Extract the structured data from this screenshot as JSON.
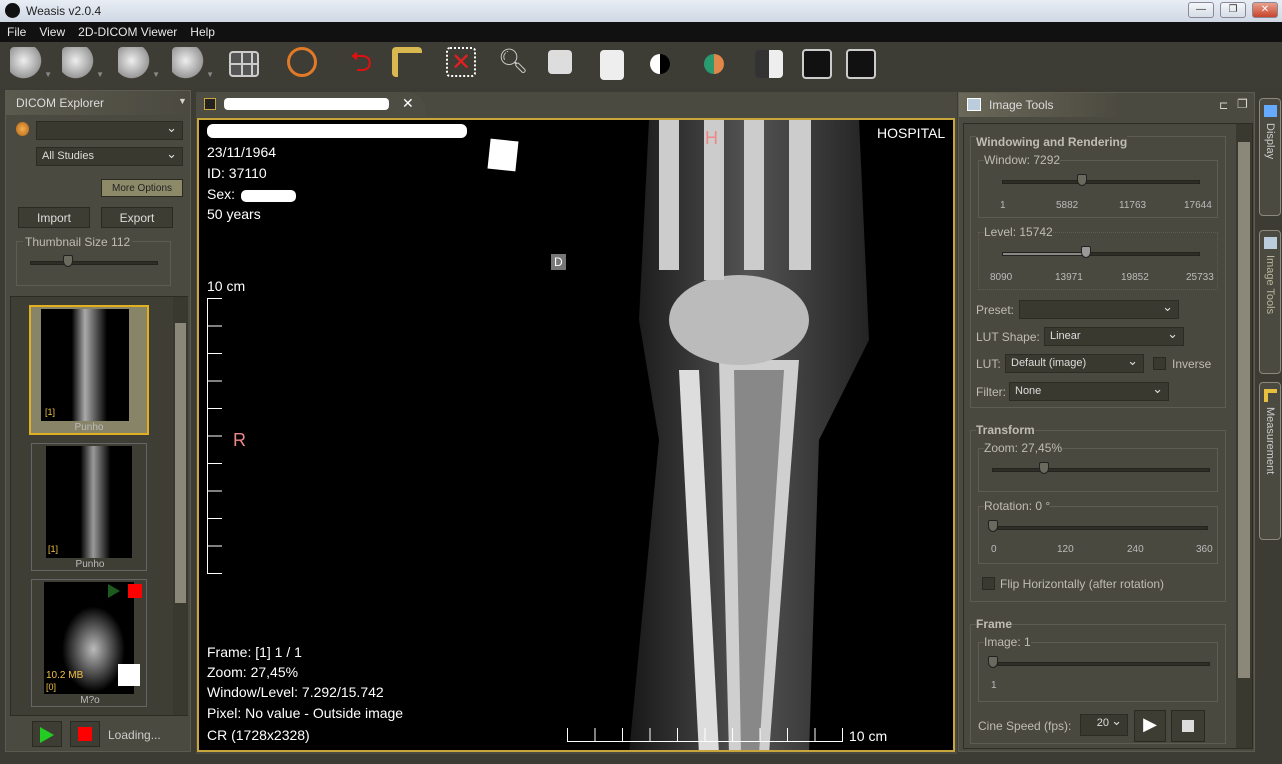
{
  "window": {
    "title": "Weasis v2.0.4",
    "controls": [
      "—",
      "❐",
      "✕"
    ]
  },
  "menu": [
    "File",
    "View",
    "2D-DICOM Viewer",
    "Help"
  ],
  "toolbar": [
    "mouse-contrast",
    "mouse-pan",
    "mouse-series",
    "mouse-stack",
    "layout-grid",
    "synchronize",
    "reset",
    "measure-ruler",
    "delete-selection",
    "zoom-magnifier",
    "lens",
    "dicom-file",
    "invert-lut",
    "color-lut",
    "contrast-lut",
    "crosshair-mpr",
    "spine-view"
  ],
  "explorer": {
    "title": "DICOM Explorer",
    "patient": "",
    "studies": "All Studies",
    "more_options": "More Options",
    "import": "Import",
    "export": "Export",
    "thumb_size_label": "Thumbnail Size 112",
    "thumb_size": 112,
    "thumbnails": [
      {
        "label": "Punho",
        "index": "[1]",
        "selected": true
      },
      {
        "label": "Punho",
        "index": "[1]",
        "selected": false
      },
      {
        "label": "M?o",
        "index": "[0]",
        "size": "10.2 MB",
        "selected": false
      }
    ],
    "loading": "Loading..."
  },
  "viewer": {
    "tab_title": "",
    "overlay": {
      "dob": "23/11/1964",
      "id": "ID: 37110",
      "sex": "Sex:",
      "age": "50 years",
      "institution": "HOSPITAL",
      "orient_top": "H",
      "orient_left": "R",
      "marker": "D",
      "scale_v": "10 cm",
      "scale_h": "10 cm",
      "frame": "Frame: [1] 1 / 1",
      "zoom": "Zoom: 27,45%",
      "wl": "Window/Level: 7.292/15.742",
      "pixel": "Pixel: No value - Outside image",
      "modality": "CR (1728x2328)"
    }
  },
  "image_tools": {
    "title": "Image Tools",
    "windowing": {
      "title": "Windowing and Rendering",
      "window_label": "Window: 7292",
      "window_value": 7292,
      "window_ticks": [
        "1",
        "5882",
        "11763",
        "17644"
      ],
      "level_label": "Level: 15742",
      "level_value": 15742,
      "level_ticks": [
        "8090",
        "13971",
        "19852",
        "25733"
      ],
      "preset_label": "Preset:",
      "preset": "",
      "lut_shape_label": "LUT Shape:",
      "lut_shape": "Linear",
      "lut_label": "LUT:",
      "lut": "Default (image)",
      "inverse": "Inverse",
      "inverse_checked": false,
      "filter_label": "Filter:",
      "filter": "None"
    },
    "transform": {
      "title": "Transform",
      "zoom_label": "Zoom: 27,45%",
      "zoom_value": 27.45,
      "rotation_label": "Rotation: 0 °",
      "rotation_value": 0,
      "rotation_ticks": [
        "0",
        "120",
        "240",
        "360"
      ],
      "flip": "Flip Horizontally (after rotation)",
      "flip_checked": false
    },
    "frame": {
      "title": "Frame",
      "image_label": "Image: 1",
      "image_value": 1,
      "image_ticks": [
        "1"
      ],
      "cine_label": "Cine Speed (fps):",
      "cine_fps": "20"
    }
  },
  "side_tabs": [
    "Display",
    "Image Tools",
    "Measurement"
  ],
  "colors": {
    "accent": "#c8a63c",
    "panel": "#4b4a40"
  }
}
